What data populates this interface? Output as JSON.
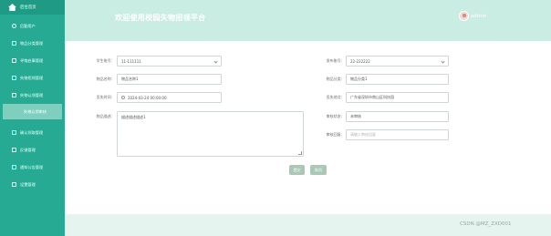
{
  "sidebar": {
    "home_label": "后台首页",
    "items": [
      {
        "label": "后勤用户"
      },
      {
        "label": "物品分类管理"
      },
      {
        "label": "寻物启事管理"
      },
      {
        "label": "失物招领管理"
      },
      {
        "label": "失物认领管理"
      },
      {
        "label": "失物认领审核"
      },
      {
        "label": "确认领取管理"
      },
      {
        "label": "反馈管理"
      },
      {
        "label": "通知公告管理"
      },
      {
        "label": "设置管理"
      }
    ]
  },
  "header": {
    "title": "欢迎使用校园失物招领平台",
    "username": "admin"
  },
  "form": {
    "student_no": {
      "label": "学生账号:",
      "value": "11-111111"
    },
    "publisher_no": {
      "label": "发布账号:",
      "value": "22-222222"
    },
    "item_name": {
      "label": "物品名称:",
      "value": "物品名称1"
    },
    "item_category": {
      "label": "物品分类:",
      "value": "物品分类1"
    },
    "lost_time": {
      "label": "丢失时间:",
      "value": "2024-03-24 00:00:00"
    },
    "lost_place": {
      "label": "丢失地点:",
      "value": "广东省深圳市南山区科技园"
    },
    "description": {
      "label": "物品描述:",
      "value": "描述描述描述1"
    },
    "review_status": {
      "label": "审核状态:",
      "value": "未审核"
    },
    "review_reply": {
      "label": "审核回复:",
      "placeholder": "请输入审核回复"
    },
    "submit_label": "提交",
    "cancel_label": "取消"
  },
  "watermark": "CSDN @MZ_ZXD001",
  "colors": {
    "sidebar": "#27aa93",
    "header": "#c9ece3",
    "content_bg": "#e6f4f0",
    "button": "#a9c9b6"
  }
}
